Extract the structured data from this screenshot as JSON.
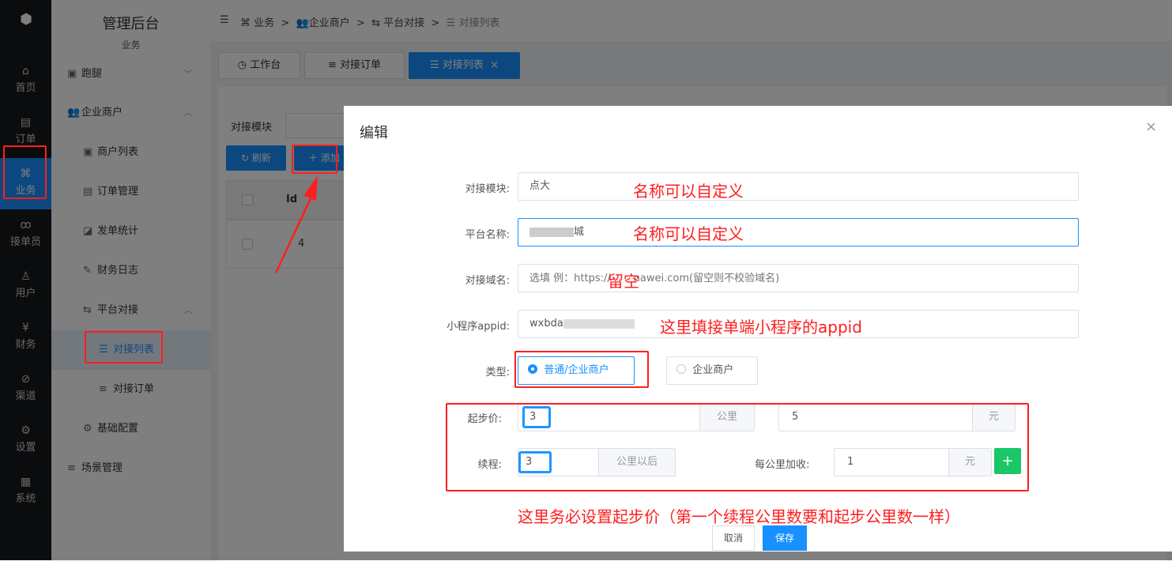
{
  "rail": {
    "items": [
      {
        "label": "首页",
        "icon": "home-icon"
      },
      {
        "label": "订单",
        "icon": "order-icon"
      },
      {
        "label": "业务",
        "icon": "command-icon",
        "active": true
      },
      {
        "label": "接单员",
        "icon": "bike-icon"
      },
      {
        "label": "用户",
        "icon": "user-icon"
      },
      {
        "label": "财务",
        "icon": "yen-icon"
      },
      {
        "label": "渠道",
        "icon": "link-icon"
      },
      {
        "label": "设置",
        "icon": "settings-icon"
      },
      {
        "label": "系统",
        "icon": "system-icon"
      }
    ]
  },
  "sidebar": {
    "title": "管理后台",
    "subtitle": "业务",
    "items": [
      {
        "label": "跑腿"
      },
      {
        "label": "企业商户"
      },
      {
        "label": "商户列表"
      },
      {
        "label": "订单管理"
      },
      {
        "label": "发单统计"
      },
      {
        "label": "财务日志"
      },
      {
        "label": "平台对接"
      },
      {
        "label": "对接列表",
        "active": true
      },
      {
        "label": "对接订单"
      },
      {
        "label": "基础配置"
      },
      {
        "label": "场景管理"
      }
    ]
  },
  "breadcrumb": [
    "业务",
    "企业商户",
    "平台对接",
    "对接列表"
  ],
  "tabs": [
    "工作台",
    "对接订单",
    "对接列表"
  ],
  "filter": {
    "label": "对接模块"
  },
  "toolbar": {
    "refresh": "刷新",
    "add": "添加"
  },
  "table": {
    "headers": [
      "Id"
    ],
    "rows": [
      [
        "4"
      ]
    ]
  },
  "modal": {
    "title": "编辑",
    "fields": {
      "module": {
        "label": "对接模块:",
        "value": "点大"
      },
      "platform": {
        "label": "平台名称:",
        "value": "城"
      },
      "domain": {
        "label": "对接域名:",
        "placeholder": "选填 例：https://       nawei.com(留空则不校验域名)"
      },
      "appid": {
        "label": "小程序appid:",
        "value": "wxbda"
      },
      "type": {
        "label": "类型:",
        "options": [
          "普通/企业商户",
          "企业商户"
        ],
        "selected": "普通/企业商户"
      },
      "start": {
        "label": "起步价:",
        "km": "3",
        "km_unit": "公里",
        "price": "5",
        "price_unit": "元"
      },
      "extra": {
        "label": "续程:",
        "km": "3",
        "km_unit": "公里以后",
        "per_label": "每公里加收:",
        "per_value": "1",
        "per_unit": "元"
      }
    },
    "cancel": "取消",
    "save": "保存"
  },
  "annotations": {
    "module": "名称可以自定义",
    "platform": "名称可以自定义",
    "domain": "留空",
    "appid": "这里填接单端小程序的appid",
    "pricing": "这里务必设置起步价（第一个续程公里数要和起步公里数一样）"
  },
  "colors": {
    "primary": "#1890ff",
    "annotation": "#ff1e1e",
    "add": "#19c767"
  }
}
